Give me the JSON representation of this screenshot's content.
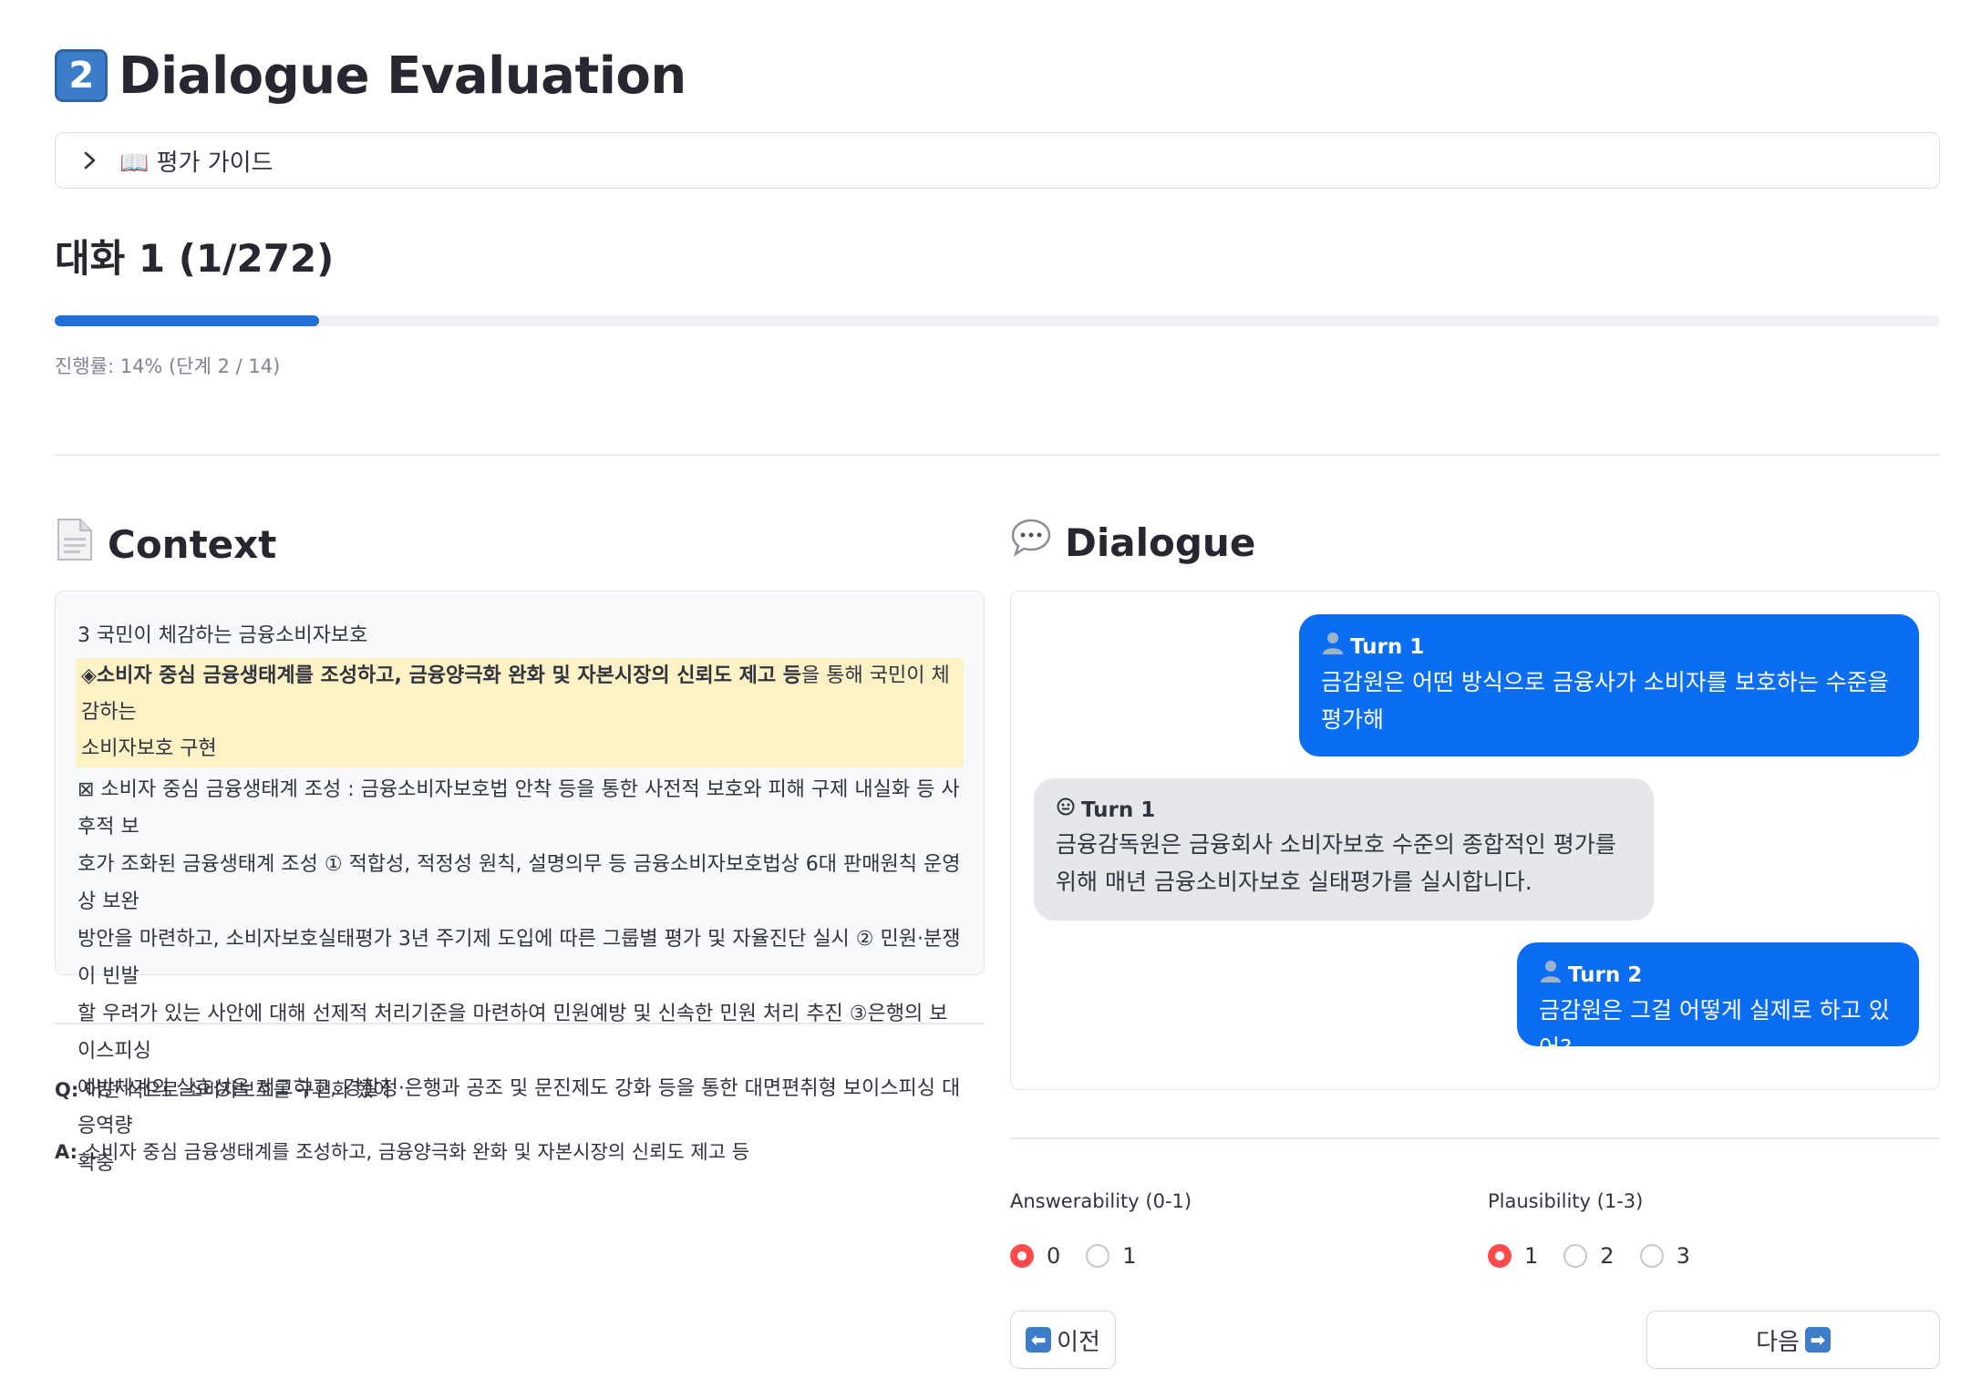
{
  "header": {
    "title_icon": "keycap-2-icon",
    "title_badge": "2",
    "title": "Dialogue Evaluation"
  },
  "guide": {
    "icon": "book-icon",
    "label": "📖 평가 가이드"
  },
  "conversation": {
    "title": "대화 1 (1/272)",
    "progress_percent": 14,
    "progress_text": "진행률: 14% (단계 2 / 14)"
  },
  "context": {
    "title": "Context",
    "icon": "page-icon",
    "lines": [
      "3 국민이 체감하는 금융소비자보호",
      "◈소비자 중심 금융생태계를 조성하고, 금융양극화 완화 및 자본시장의 신뢰도 제고 등",
      "을 통해 국민이 체감하는",
      "소비자보호 구현",
      "⊠ 소비자 중심 금융생태계 조성 : 금융소비자보호법 안착 등을 통한 사전적 보호와 피해 구제 내실화 등 사후적 보",
      "호가 조화된 금융생태계 조성 ① 적합성, 적정성 원칙, 설명의무 등 금융소비자보호법상 6대 판매원칙 운영상 보완",
      "방안을 마련하고, 소비자보호실태평가 3년 주기제 도입에 따른 그룹별 평가 및 자율진단 실시 ② 민원·분쟁이 빈발",
      "할 우려가 있는 사안에 대해 선제적 처리기준을 마련하여 민원예방 및 신속한 민원 처리 추진 ③은행의 보이스피싱",
      "예방체계의 실효성을 제고하고, 경찰청·은행과 공조 및 문진제도 강화 등을 통한 대면편취형 보이스피싱 대응역량",
      "확충"
    ]
  },
  "qa": {
    "q_label": "Q:",
    "q_text": "어떤 식으로 소비자보호를 구현화 했어",
    "a_label": "A:",
    "a_text": "소비자 중심 금융생태계를 조성하고, 금융양극화 완화 및 자본시장의 신뢰도 제고 등"
  },
  "dialogue": {
    "title": "Dialogue",
    "icon": "speech-bubble-icon",
    "turns": [
      {
        "role": "user",
        "icon": "user-silhouette-icon",
        "label": "Turn 1",
        "text": "금감원은 어떤 방식으로 금융사가 소비자를 보호하는 수준을 평가해"
      },
      {
        "role": "bot",
        "icon": "robot-face-icon",
        "label": "Turn 1",
        "text": "금융감독원은 금융회사 소비자보호 수준의 종합적인 평가를 위해 매년 금융소비자보호 실태평가를 실시합니다."
      },
      {
        "role": "user",
        "icon": "user-silhouette-icon",
        "label": "Turn 2",
        "text": "금감원은 그걸 어떻게 실제로 하고 있어?"
      }
    ]
  },
  "ratings": {
    "answerability": {
      "label": "Answerability (0-1)",
      "options": [
        "0",
        "1"
      ],
      "selected": "0"
    },
    "plausibility": {
      "label": "Plausibility (1-3)",
      "options": [
        "1",
        "2",
        "3"
      ],
      "selected": "1"
    }
  },
  "nav": {
    "prev_icon": "left-arrow-icon",
    "prev_label": "이전",
    "next_label": "다음",
    "next_icon": "right-arrow-icon"
  },
  "colors": {
    "user_bubble": "#0b6ef2",
    "bot_bubble": "#e5e7ea",
    "progress": "#1f6fd6",
    "radio_selected": "#ff4b4b",
    "highlight": "#fdf2c5"
  }
}
